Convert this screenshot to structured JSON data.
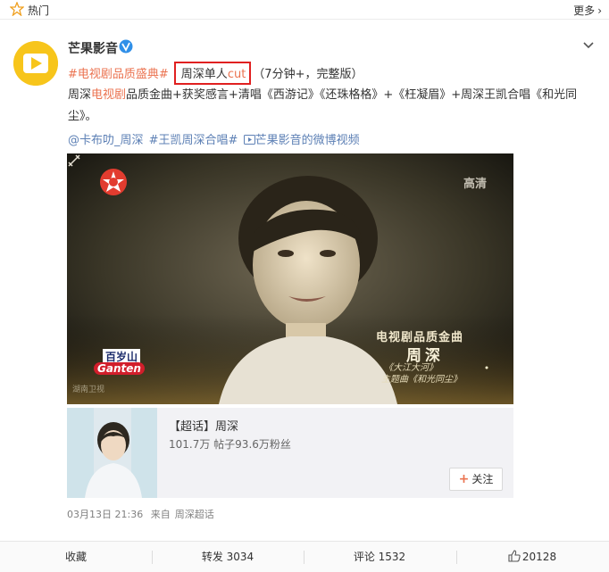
{
  "topbar": {
    "hot_label": "热门",
    "more_label": "更多"
  },
  "post": {
    "username": "芒果影音",
    "tag1": "#电视剧品质盛典#",
    "boxed_prefix": "周深单人",
    "boxed_suffix": "cut",
    "after_box": "（7分钟+，完整版）",
    "body_part1": "周深",
    "body_highlight": "电视剧",
    "body_part2": "品质金曲+获奖感言+清唱《西游记》《还珠格格》+《枉凝眉》+周深王凯合唱《和光同尘》。",
    "links": [
      "@卡布叻_周深",
      "#王凯周深合唱#",
      "芒果影音的微博视频"
    ]
  },
  "video": {
    "hd_label": "高清",
    "caption1": "电视剧品质金曲",
    "caption2": "周深",
    "caption3": "《大江大河》",
    "caption4": "主题曲《和光同尘》",
    "brand_top": "百岁山",
    "brand_main": "Ganten",
    "watermark": "湖南卫视"
  },
  "card": {
    "title": "【超话】周深",
    "stats": "101.7万 帖子93.6万粉丝",
    "follow_label": "关注"
  },
  "meta": {
    "date": "03月13日 21:36",
    "source_prefix": "来自",
    "source": "周深超话"
  },
  "actions": {
    "favorite": "收藏",
    "repost": "转发 3034",
    "comment": "评论 1532",
    "like": "20128"
  },
  "colors": {
    "accent": "#eb7350",
    "link": "#5d80b5",
    "box": "#e02020",
    "avatar_bg": "#f7c51b"
  }
}
